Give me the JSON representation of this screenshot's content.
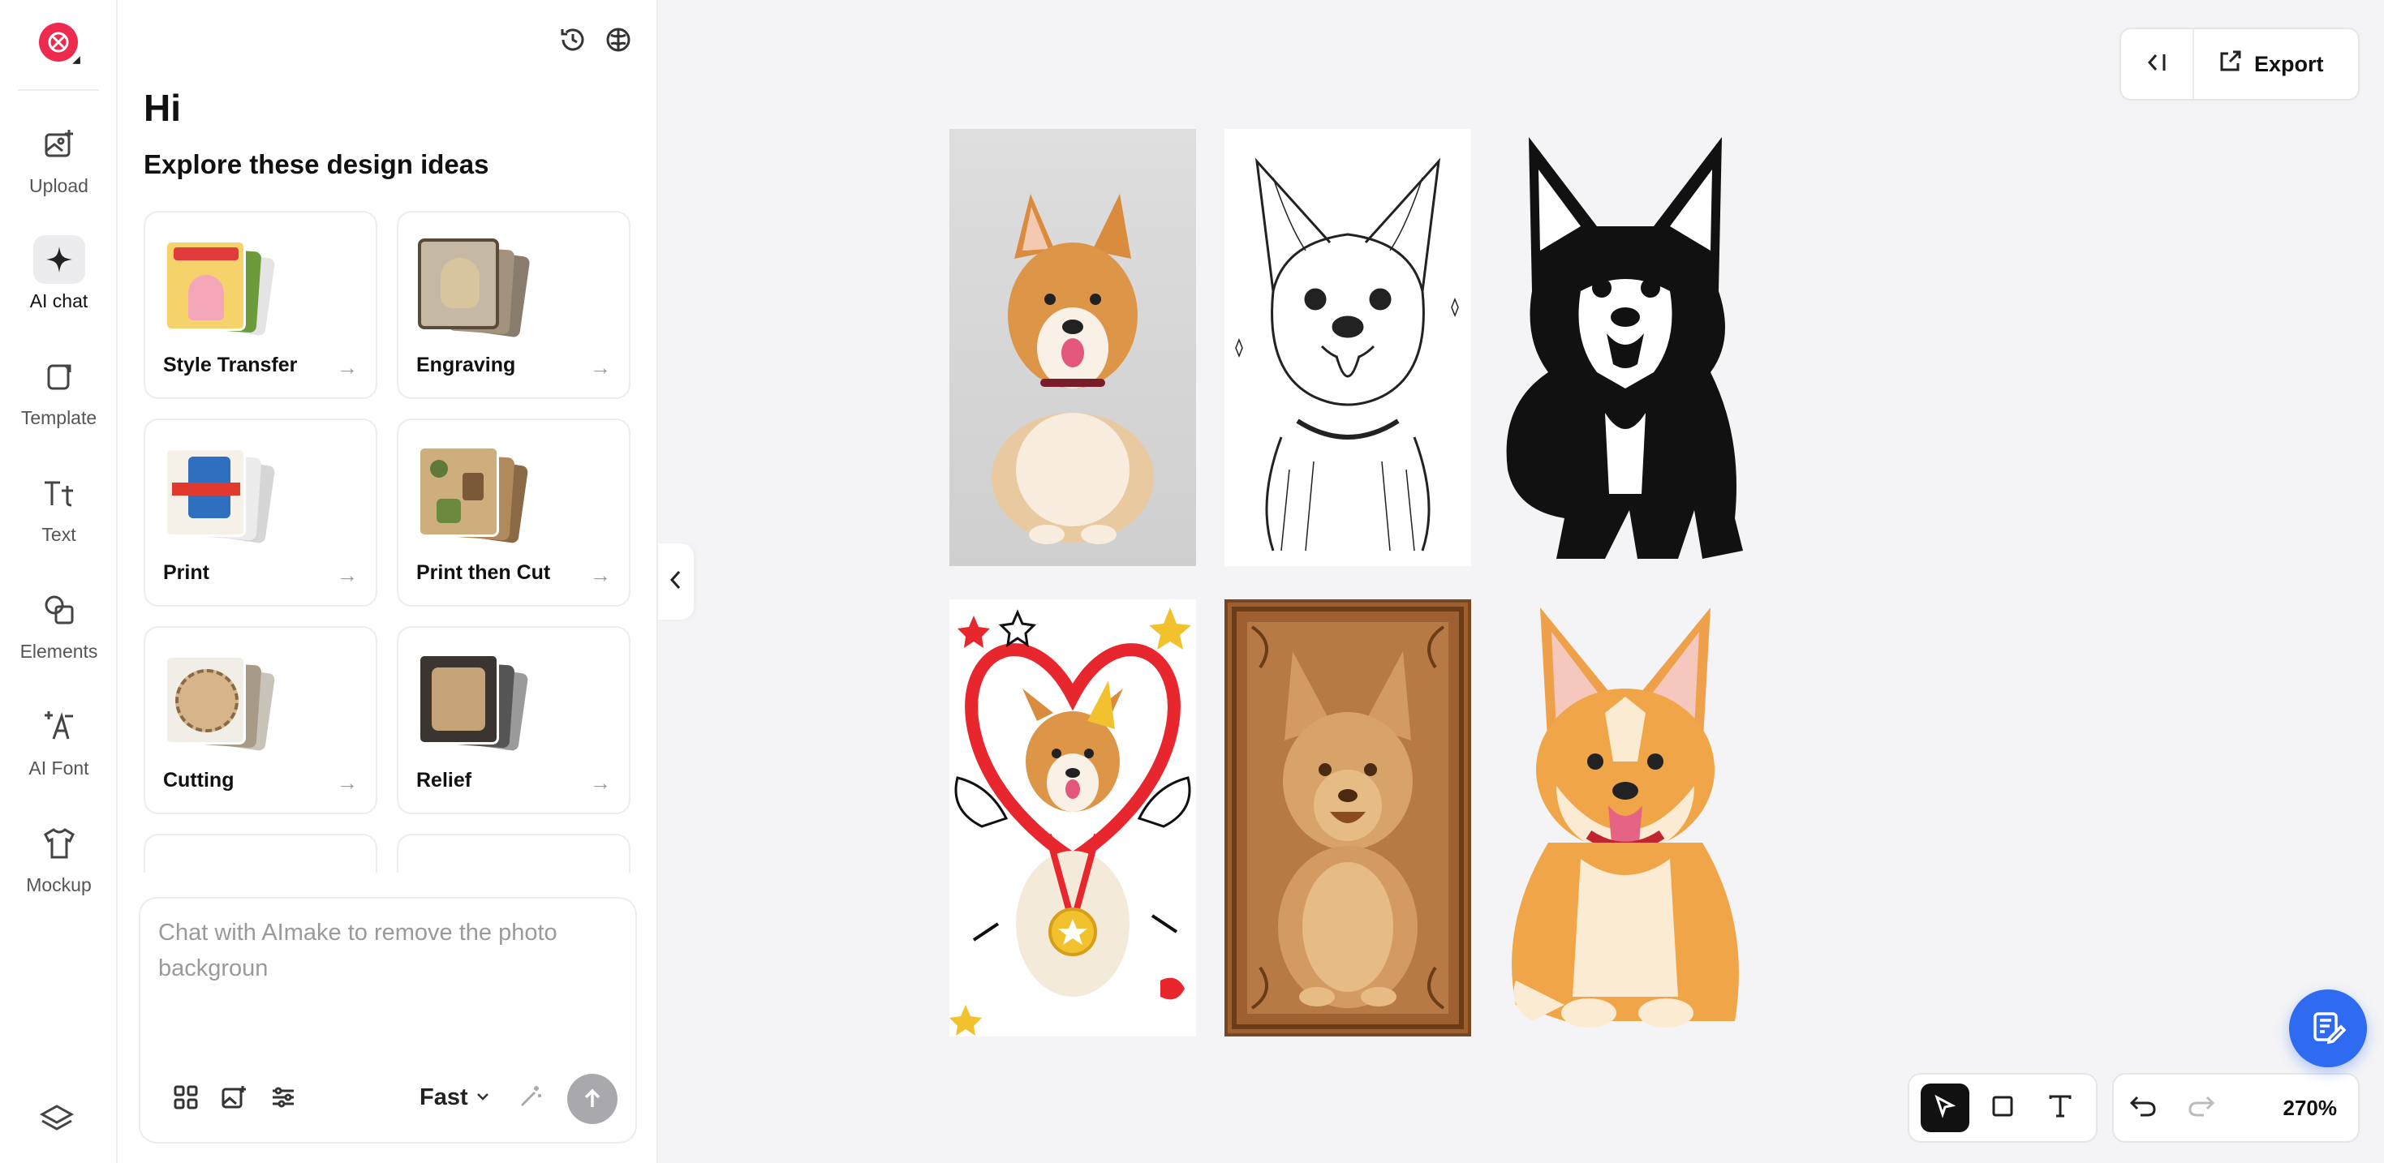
{
  "rail": {
    "items": [
      {
        "label": "Upload",
        "icon": "upload-image-icon"
      },
      {
        "label": "AI chat",
        "icon": "sparkle-icon"
      },
      {
        "label": "Template",
        "icon": "template-icon"
      },
      {
        "label": "Text",
        "icon": "text-icon"
      },
      {
        "label": "Elements",
        "icon": "shapes-icon"
      },
      {
        "label": "AI Font",
        "icon": "ai-font-icon"
      },
      {
        "label": "Mockup",
        "icon": "tshirt-icon"
      }
    ],
    "active": "AI chat"
  },
  "panel": {
    "greeting": "Hi",
    "subtitle": "Explore these design ideas",
    "ideas": [
      {
        "name": "Style Transfer"
      },
      {
        "name": "Engraving"
      },
      {
        "name": "Print"
      },
      {
        "name": "Print then Cut"
      },
      {
        "name": "Cutting"
      },
      {
        "name": "Relief"
      }
    ]
  },
  "chat": {
    "placeholder": "Chat with AImake to remove the photo backgroun",
    "mode": "Fast"
  },
  "topbar": {
    "export_label": "Export"
  },
  "canvas": {
    "zoom": "270%"
  },
  "colors": {
    "brand": "#ef2a4f",
    "fab": "#2f6bf0",
    "corgi_orange": "#e8a24a"
  }
}
